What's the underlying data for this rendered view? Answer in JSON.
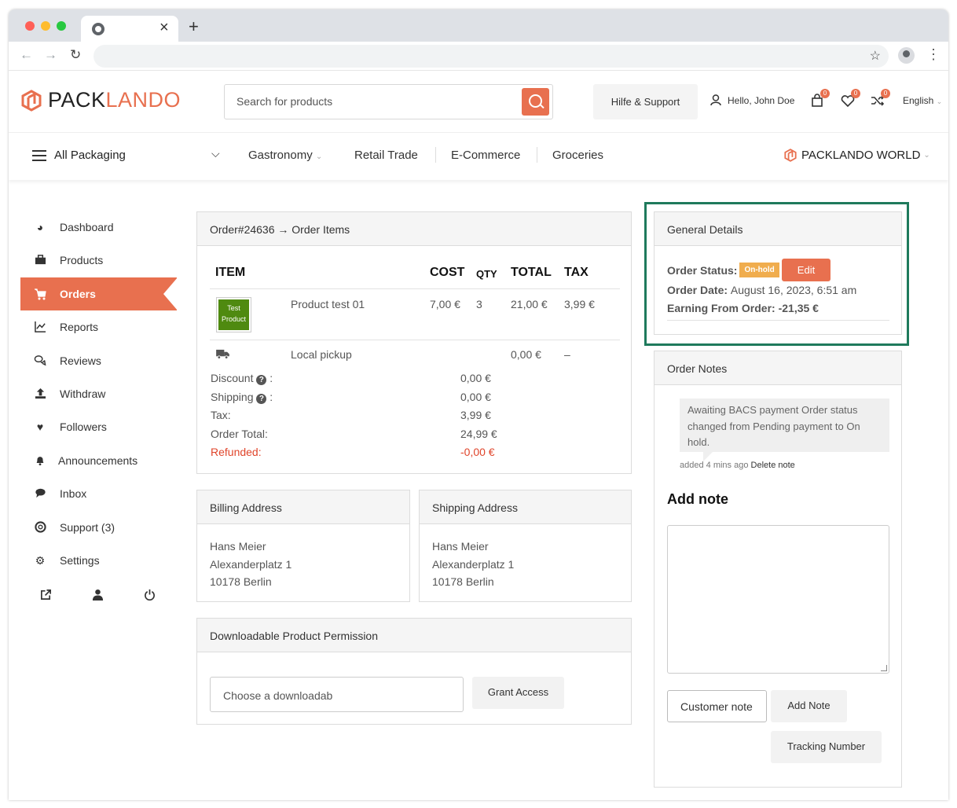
{
  "browser": {
    "tab_close": "×",
    "new_tab": "+",
    "back": "←",
    "forward": "→",
    "reload": "↻",
    "bookmark": "☆",
    "menu": "⋮"
  },
  "header": {
    "logo_part1": "PACK",
    "logo_part2": "LANDO",
    "search_placeholder": "Search for products",
    "support": "Hilfe & Support",
    "greeting": "Hello, John Doe",
    "cart_count": "0",
    "wishlist_count": "0",
    "compare_count": "0",
    "language": "English"
  },
  "menu": {
    "all": "All Packaging",
    "items": [
      "Gastronomy",
      "Retail Trade",
      "E-Commerce",
      "Groceries"
    ],
    "world": "PACKLANDO WORLD"
  },
  "sidebar": {
    "items": [
      {
        "label": "Dashboard",
        "icon": "dashboard-icon"
      },
      {
        "label": "Products",
        "icon": "briefcase-icon"
      },
      {
        "label": "Orders",
        "icon": "cart-icon"
      },
      {
        "label": "Reports",
        "icon": "chart-icon"
      },
      {
        "label": "Reviews",
        "icon": "comments-icon"
      },
      {
        "label": "Withdraw",
        "icon": "upload-icon"
      },
      {
        "label": "Followers",
        "icon": "heart-icon"
      },
      {
        "label": "Announcements",
        "icon": "bell-icon"
      },
      {
        "label": "Inbox",
        "icon": "chat-icon"
      },
      {
        "label": "Support (3)",
        "icon": "lifebuoy-icon"
      },
      {
        "label": "Settings",
        "icon": "gear-icon"
      }
    ]
  },
  "order": {
    "title": "Order#24636 → Order Items",
    "columns": {
      "item": "ITEM",
      "cost": "COST",
      "qty": "QTY",
      "total": "TOTAL",
      "tax": "TAX"
    },
    "product": {
      "thumb_line1": "Test",
      "thumb_line2": "Product",
      "name": "Product test 01",
      "cost": "7,00 €",
      "qty": "3",
      "total": "21,00 €",
      "tax": "3,99 €"
    },
    "shipping": {
      "name": "Local pickup",
      "total": "0,00 €",
      "tax": "–"
    },
    "summary": {
      "discount_label": "Discount",
      "discount": "0,00 €",
      "shipping_label": "Shipping",
      "shipping": "0,00 €",
      "tax_label": "Tax:",
      "tax": "3,99 €",
      "total_label": "Order Total:",
      "total": "24,99 €",
      "refunded_label": "Refunded:",
      "refunded": "-0,00 €"
    }
  },
  "billing": {
    "title": "Billing Address",
    "name": "Hans Meier",
    "street": "Alexanderplatz 1",
    "city": "10178 Berlin"
  },
  "shipping_address": {
    "title": "Shipping Address",
    "name": "Hans Meier",
    "street": "Alexanderplatz 1",
    "city": "10178 Berlin"
  },
  "downloads": {
    "title": "Downloadable Product Permission",
    "placeholder": "Choose a downloadab",
    "grant": "Grant Access"
  },
  "general": {
    "title": "General Details",
    "status_label": "Order Status:",
    "status": "On-hold",
    "edit": "Edit",
    "date_label": "Order Date:",
    "date": "August 16, 2023, 6:51 am",
    "earning_label": "Earning From Order:",
    "earning": "-21,35 €"
  },
  "notes": {
    "title": "Order Notes",
    "note_text": "Awaiting BACS payment Order status changed from Pending payment to On hold.",
    "added": "added",
    "added_time": "4 mins ago",
    "delete": "Delete note",
    "add_title": "Add note",
    "note_type": "Customer note",
    "add_button": "Add Note",
    "tracking_button": "Tracking Number"
  },
  "colors": {
    "accent": "#e8704f",
    "highlight_border": "#1f7a5c",
    "status_onhold": "#f0ad4e",
    "refunded": "#e0452b"
  }
}
